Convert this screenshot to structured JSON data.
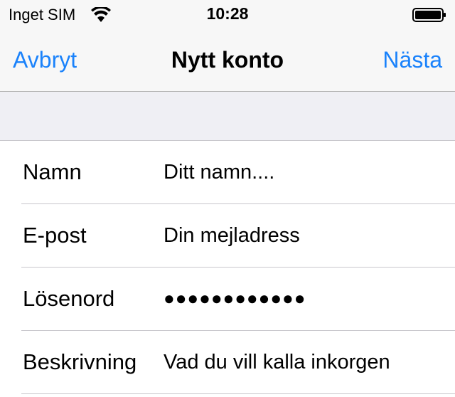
{
  "status_bar": {
    "carrier": "Inget SIM",
    "time": "10:28",
    "wifi_icon": "wifi-icon",
    "battery_icon": "battery-icon"
  },
  "nav": {
    "cancel_label": "Avbryt",
    "title": "Nytt konto",
    "next_label": "Nästa",
    "accent_color": "#1a82fb"
  },
  "form": {
    "rows": [
      {
        "label": "Namn",
        "placeholder": "Ditt namn...."
      },
      {
        "label": "E-post",
        "placeholder": "Din mejladress"
      },
      {
        "label": "Lösenord",
        "value": "●●●●●●●●●●●●"
      },
      {
        "label": "Beskrivning",
        "placeholder": "Vad du vill kalla inkorgen"
      }
    ]
  }
}
